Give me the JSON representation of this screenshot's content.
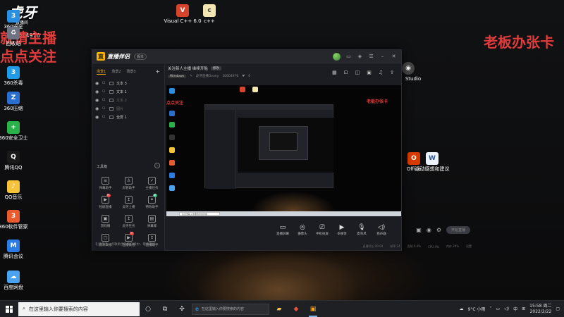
{
  "overlay": {
    "left_line1": "就请主播",
    "left_line2": "点点关注",
    "right_banner": "老板办张卡",
    "huya_logo": "虎牙",
    "huya_sub": "直播间",
    "room_id": "10604976"
  },
  "desktop_icons": [
    {
      "label": "360安全",
      "color": "#2a8fe0",
      "glyph": "3"
    },
    {
      "label": "回收站",
      "color": "#6d7380",
      "glyph": "♻"
    },
    {
      "label": "360杀毒",
      "color": "#1f9be8",
      "glyph": "3"
    },
    {
      "label": "360压缩",
      "color": "#2a6fd0",
      "glyph": "Z"
    },
    {
      "label": "360安全卫士",
      "color": "#2bb14a",
      "glyph": "+"
    },
    {
      "label": "腾讯QQ",
      "color": "#1a1a1a",
      "glyph": "Q"
    },
    {
      "label": "QQ音乐",
      "color": "#f6c23a",
      "glyph": "♪"
    },
    {
      "label": "360软件管家",
      "color": "#e95b2e",
      "glyph": "3"
    },
    {
      "label": "腾讯会议",
      "color": "#2c7ce5",
      "glyph": "M"
    },
    {
      "label": "百度网盘",
      "color": "#4aa3f0",
      "glyph": "☁"
    }
  ],
  "top_icons": [
    {
      "label": "Visual C++ 6.0",
      "color": "#d7442c",
      "glyph": "V"
    },
    {
      "label": "c++",
      "color": "#f3e6b0",
      "glyph": "c"
    }
  ],
  "right_icons": {
    "studio_label": "Studio",
    "office_label": "Office",
    "doc_label": "活动感想和建议"
  },
  "app": {
    "title": "直播伴侣",
    "version": "版本",
    "scene_tabs": [
      "场景1",
      "场景2",
      "场景3"
    ],
    "sources": [
      {
        "name": "文本 3",
        "dim": false
      },
      {
        "name": "文本 1",
        "dim": false
      },
      {
        "name": "文本 2",
        "dim": true
      },
      {
        "name": "图片",
        "dim": true
      },
      {
        "name": "全屏 1",
        "dim": false
      }
    ],
    "toolbox_title": "工具箱",
    "tools": [
      {
        "label": "弹幕助手",
        "glyph": "≡",
        "badge": ""
      },
      {
        "label": "房管助手",
        "glyph": "♙",
        "badge": ""
      },
      {
        "label": "主播任务",
        "glyph": "✓",
        "badge": ""
      },
      {
        "label": "短剧直播",
        "glyph": "▶",
        "badge": "热"
      },
      {
        "label": "虎牙上播",
        "glyph": "↥",
        "badge": ""
      },
      {
        "label": "特效助手",
        "glyph": "✦",
        "badge": "新"
      },
      {
        "label": "游戏赚",
        "glyph": "▣",
        "badge": ""
      },
      {
        "label": "虎牙任务",
        "glyph": "↥",
        "badge": ""
      },
      {
        "label": "弹幕库",
        "glyph": "▤",
        "badge": ""
      },
      {
        "label": "虎牙日报",
        "glyph": "▢",
        "badge": ""
      },
      {
        "label": "直播教程",
        "glyph": "▶",
        "badge": "热"
      },
      {
        "label": "直播助手",
        "glyph": "↥",
        "badge": ""
      }
    ],
    "tips": "礼物任务、点歌助手功能升级中，敬请期待",
    "announce": "关注新人主播 继续开船",
    "edit_label": "修改",
    "stream_category": "Windows",
    "stream_title": "虎牙直播Ovany",
    "stream_room": "10604976",
    "stream_fans": "0",
    "preview_red_text": "老板办张卡",
    "preview_left_red": "点点关注",
    "preview_search": "在这里输入你要搜索的内容",
    "bottom_buttons": [
      "直播屏幕",
      "摄像头",
      "手机投屏",
      "多媒体",
      "麦克风",
      "扬声器"
    ],
    "go_live": "开始直播",
    "status": [
      "直播时长 00:00",
      "帧率 24",
      "丢帧 0.0%",
      "CPU 4%",
      "内存 29%",
      "设置"
    ]
  },
  "taskbar": {
    "search_placeholder": "在这里输入你要搜索的内容",
    "weather": "9°C 小雨",
    "time": "15:58 周二",
    "date": "2022/2/22"
  }
}
